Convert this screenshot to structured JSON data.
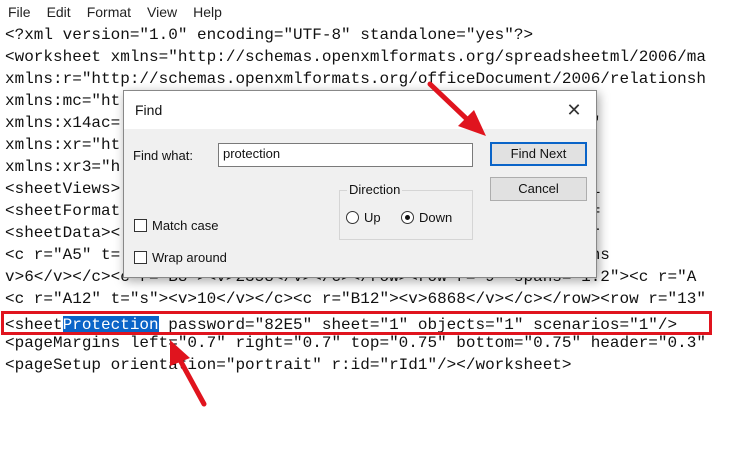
{
  "menu": [
    "File",
    "Edit",
    "Format",
    "View",
    "Help"
  ],
  "lines": [
    "<?xml version=\"1.0\" encoding=\"UTF-8\" standalone=\"yes\"?>",
    "<worksheet xmlns=\"http://schemas.openxmlformats.org/spreadsheetml/2006/ma",
    "xmlns:r=\"http://schemas.openxmlformats.org/officeDocument/2006/relationsh",
    "xmlns:mc=\"ht                                   ility/2006\" mo",
    "xmlns:x14ac=                                    tml/2009/9/ac\"",
    "xmlns:xr=\"ht                                   /2014/revision",
    "xmlns:xr3=\"h                                   l/2016/revisio",
    "<sheetViews>                                    selection acti",
    "<sheetFormat                                    max=\"1\" width=",
    "<sheetData><                                    18</v></c><c r",
    "<c r=\"A5\" t=                                   <row r=\"6\" spans",
    "v>6</v></c><c r=\"B8\"><v>2358</v></c></row><row r=\"9\" spans=\"1:2\"><c r=\"A",
    "<c r=\"A12\" t=\"s\"><v>10</v></c><c r=\"B12\"><v>6868</v></c></row><row r=\"13\"",
    "",
    "<pageMargins left=\"0.7\" right=\"0.7\" top=\"0.75\" bottom=\"0.75\" header=\"0.3\"",
    "<pageSetup orientation=\"portrait\" r:id=\"rId1\"/></worksheet>"
  ],
  "highlight_line": {
    "before": "<sheet",
    "match": "Protection",
    "after": " password=\"82E5\" sheet=\"1\" objects=\"1\" scenarios=\"1\"/>"
  },
  "find_dialog": {
    "title": "Find",
    "close": "✕",
    "find_what_label": "Find what:",
    "find_what_value": "protection",
    "find_next": "Find Next",
    "cancel": "Cancel",
    "direction_label": "Direction",
    "up_label": "Up",
    "down_label": "Down",
    "direction_selected": "Down",
    "match_case_label": "Match case",
    "match_case_checked": false,
    "wrap_around_label": "Wrap around",
    "wrap_around_checked": false
  },
  "colors": {
    "annotation_red": "#e0141e",
    "selection_blue": "#0a64c8"
  }
}
